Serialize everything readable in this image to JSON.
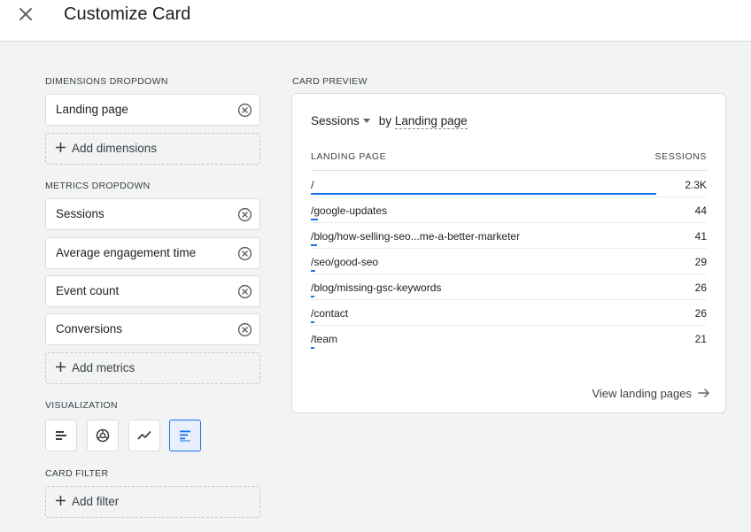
{
  "header": {
    "title": "Customize Card",
    "close_icon": "close-icon"
  },
  "dimensions": {
    "label": "DIMENSIONS DROPDOWN",
    "items": [
      {
        "label": "Landing page"
      }
    ],
    "add_label": "Add dimensions"
  },
  "metrics": {
    "label": "METRICS DROPDOWN",
    "items": [
      {
        "label": "Sessions"
      },
      {
        "label": "Average engagement time"
      },
      {
        "label": "Event count"
      },
      {
        "label": "Conversions"
      }
    ],
    "add_label": "Add metrics"
  },
  "visualization": {
    "label": "VISUALIZATION",
    "options": [
      {
        "icon": "bar-chart-icon",
        "selected": false
      },
      {
        "icon": "donut-chart-icon",
        "selected": false
      },
      {
        "icon": "line-chart-icon",
        "selected": false
      },
      {
        "icon": "table-bar-icon",
        "selected": true
      }
    ]
  },
  "card_filter": {
    "label": "CARD FILTER",
    "add_label": "Add filter"
  },
  "preview": {
    "label": "CARD PREVIEW",
    "metric": "Sessions",
    "by_text": "by",
    "dimension": "Landing page",
    "col_dimension": "LANDING PAGE",
    "col_metric": "SESSIONS",
    "rows": [
      {
        "page": "/",
        "value": "2.3K",
        "bar_fraction": 0.873
      },
      {
        "page": "/google-updates",
        "value": "44",
        "bar_fraction": 0.017
      },
      {
        "page": "/blog/how-selling-seo...me-a-better-marketer",
        "value": "41",
        "bar_fraction": 0.016
      },
      {
        "page": "/seo/good-seo",
        "value": "29",
        "bar_fraction": 0.011
      },
      {
        "page": "/blog/missing-gsc-keywords",
        "value": "26",
        "bar_fraction": 0.01
      },
      {
        "page": "/contact",
        "value": "26",
        "bar_fraction": 0.01
      },
      {
        "page": "/team",
        "value": "21",
        "bar_fraction": 0.008
      }
    ],
    "view_link": "View landing pages"
  },
  "colors": {
    "accent": "#1a73e8",
    "selected_bg": "#e8f0fe",
    "border": "#dadce0",
    "background": "#f1f3f4"
  }
}
